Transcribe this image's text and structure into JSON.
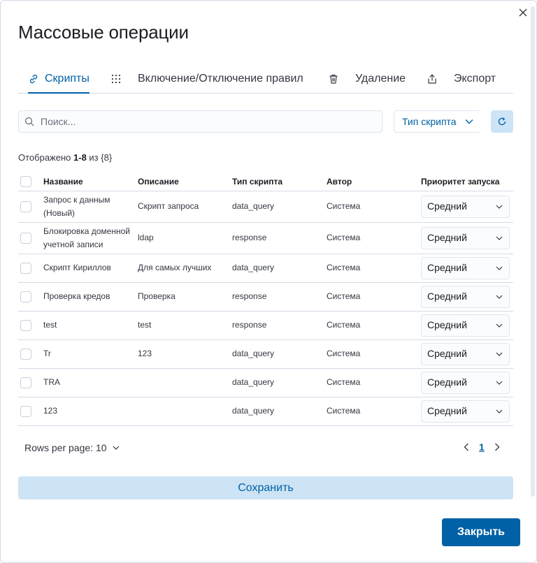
{
  "modal": {
    "title": "Массовые операции",
    "close_icon": "close-icon"
  },
  "tabs": [
    {
      "label": "Скрипты",
      "icon": "link-icon",
      "active": true
    },
    {
      "label": "Включение/Отключение правил",
      "icon": "grid-dots-icon",
      "active": false
    },
    {
      "label": "Удаление",
      "icon": "trash-icon",
      "active": false
    },
    {
      "label": "Экспорт",
      "icon": "export-icon",
      "active": false
    }
  ],
  "search": {
    "placeholder": "Поиск...",
    "value": ""
  },
  "filter": {
    "label": "Тип скрипта"
  },
  "summary": {
    "prefix": "Отображено ",
    "range": "1-8",
    "suffix": " из {8}"
  },
  "table": {
    "headers": {
      "name": "Название",
      "description": "Описание",
      "type": "Тип скрипта",
      "author": "Автор",
      "priority": "Приоритет запуска"
    },
    "rows": [
      {
        "name": "Запрос к данным (Новый)",
        "description": "Скрипт запроса",
        "type": "data_query",
        "author": "Система",
        "priority": "Средний"
      },
      {
        "name": "Блокировка доменной учетной записи",
        "description": "ldap",
        "type": "response",
        "author": "Система",
        "priority": "Средний"
      },
      {
        "name": "Скрипт Кириллов",
        "description": "Для самых лучших",
        "type": "data_query",
        "author": "Система",
        "priority": "Средний"
      },
      {
        "name": "Проверка кредов",
        "description": "Проверка",
        "type": "response",
        "author": "Система",
        "priority": "Средний"
      },
      {
        "name": "test",
        "description": "test",
        "type": "response",
        "author": "Система",
        "priority": "Средний"
      },
      {
        "name": "Tr",
        "description": "123",
        "type": "data_query",
        "author": "Система",
        "priority": "Средний"
      },
      {
        "name": "TRA",
        "description": "",
        "type": "data_query",
        "author": "Система",
        "priority": "Средний"
      },
      {
        "name": "123",
        "description": "",
        "type": "data_query",
        "author": "Система",
        "priority": "Средний"
      }
    ]
  },
  "pagination": {
    "rows_per_page_label": "Rows per page: 10",
    "current_page": "1"
  },
  "buttons": {
    "save": "Сохранить",
    "close": "Закрыть"
  },
  "colors": {
    "accent": "#0061a6",
    "accent_light": "#cce4f5",
    "border": "#d3dae6"
  }
}
